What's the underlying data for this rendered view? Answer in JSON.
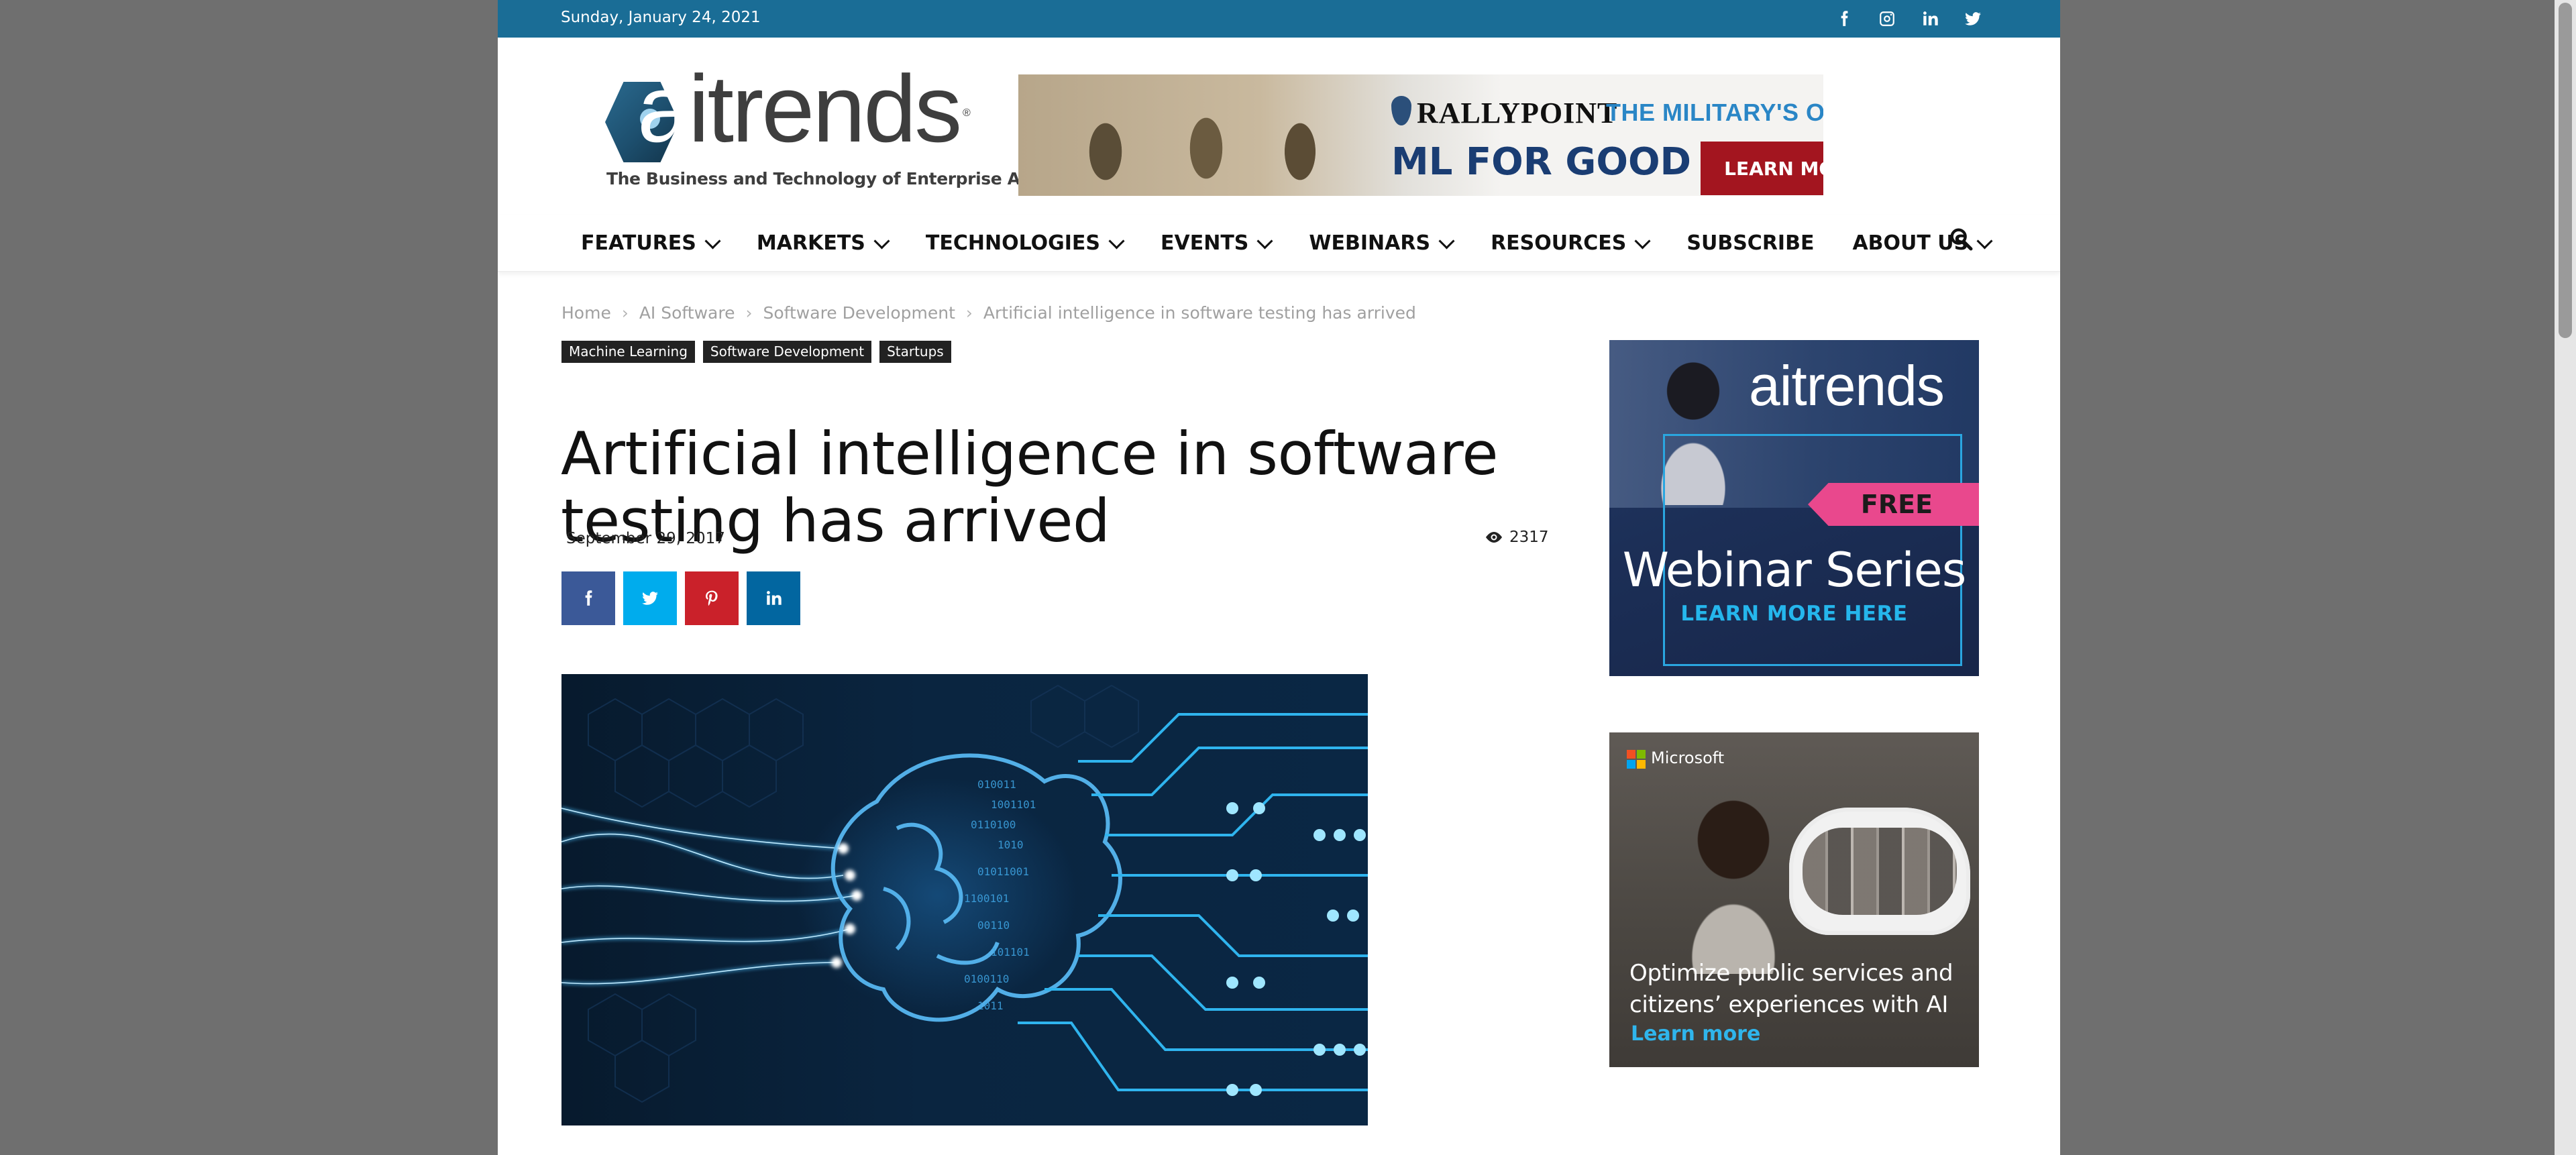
{
  "topbar": {
    "date": "Sunday, January 24, 2021",
    "social": [
      "facebook-icon",
      "instagram-icon",
      "linkedin-icon",
      "twitter-icon"
    ]
  },
  "logo": {
    "wordmark_a": "a",
    "wordmark_rest": "itrends",
    "registered": "®",
    "tagline": "The Business and Technology of Enterprise AI"
  },
  "banner": {
    "brand": "RALLYPOINT",
    "tagline": "THE MILITARY'S ONLINE NETWORK",
    "headline": "ML FOR GOOD",
    "cta": "LEARN MORE"
  },
  "nav": {
    "items": [
      {
        "label": "FEATURES",
        "dropdown": true
      },
      {
        "label": "MARKETS",
        "dropdown": true
      },
      {
        "label": "TECHNOLOGIES",
        "dropdown": true
      },
      {
        "label": "EVENTS",
        "dropdown": true
      },
      {
        "label": "WEBINARS",
        "dropdown": true
      },
      {
        "label": "RESOURCES",
        "dropdown": true
      },
      {
        "label": "SUBSCRIBE",
        "dropdown": false
      },
      {
        "label": "ABOUT US",
        "dropdown": true
      }
    ]
  },
  "breadcrumb": {
    "items": [
      "Home",
      "AI Software",
      "Software Development",
      "Artificial intelligence in software testing has arrived"
    ],
    "separator": "›"
  },
  "article": {
    "tags": [
      "Machine Learning",
      "Software Development",
      "Startups"
    ],
    "title": "Artificial intelligence in software testing has arrived",
    "date": "September 29, 2017",
    "views": "2317",
    "share": [
      {
        "icon": "facebook-icon",
        "color": "#3b5998"
      },
      {
        "icon": "twitter-icon",
        "color": "#00aced"
      },
      {
        "icon": "pinterest-icon",
        "color": "#ca212a"
      },
      {
        "icon": "linkedin-icon",
        "color": "#0266a0"
      }
    ]
  },
  "sidebar": {
    "webinar_ad": {
      "logo": "aitrends",
      "badge": "FREE",
      "headline": "Webinar Series",
      "cta": "LEARN MORE HERE"
    },
    "microsoft_ad": {
      "brand": "Microsoft",
      "text": "Optimize public services and citizens’ experiences with AI",
      "cta": "Learn more"
    }
  },
  "colors": {
    "topbar": "#1a6d96",
    "page_background": "#6f6f6f",
    "tag_background": "#222222",
    "banner_cta": "#a3151f"
  }
}
